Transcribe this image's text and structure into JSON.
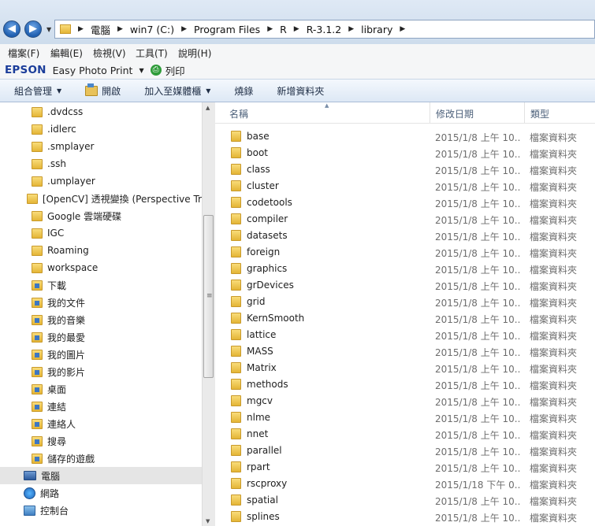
{
  "address": {
    "back_glyph": "◀",
    "forward_glyph": "▶",
    "crumbs": [
      "電腦",
      "win7 (C:)",
      "Program Files",
      "R",
      "R-3.1.2",
      "library"
    ]
  },
  "menu": [
    "檔案(F)",
    "編輯(E)",
    "檢視(V)",
    "工具(T)",
    "說明(H)"
  ],
  "epson": {
    "logo": "EPSON",
    "app": "Easy Photo Print",
    "print_label": "列印"
  },
  "toolbar": {
    "organize": "組合管理",
    "open": "開啟",
    "add_to_library": "加入至媒體櫃",
    "burn": "燒錄",
    "new_folder": "新增資料夾"
  },
  "sidebar": {
    "items": [
      {
        "label": ".dvdcss",
        "icon": "folder"
      },
      {
        "label": ".idlerc",
        "icon": "folder"
      },
      {
        "label": ".smplayer",
        "icon": "folder"
      },
      {
        "label": ".ssh",
        "icon": "folder"
      },
      {
        "label": ".umplayer",
        "icon": "folder"
      },
      {
        "label": "[OpenCV] 透視變換 (Perspective Tr",
        "icon": "folder"
      },
      {
        "label": "Google 雲端硬碟",
        "icon": "folder"
      },
      {
        "label": "IGC",
        "icon": "folder"
      },
      {
        "label": "Roaming",
        "icon": "folder"
      },
      {
        "label": "workspace",
        "icon": "folder"
      },
      {
        "label": "下載",
        "icon": "library-folder"
      },
      {
        "label": "我的文件",
        "icon": "library-folder"
      },
      {
        "label": "我的音樂",
        "icon": "library-folder"
      },
      {
        "label": "我的最愛",
        "icon": "library-folder"
      },
      {
        "label": "我的圖片",
        "icon": "library-folder"
      },
      {
        "label": "我的影片",
        "icon": "library-folder"
      },
      {
        "label": "桌面",
        "icon": "library-folder"
      },
      {
        "label": "連結",
        "icon": "library-folder"
      },
      {
        "label": "連絡人",
        "icon": "library-folder"
      },
      {
        "label": "搜尋",
        "icon": "library-folder"
      },
      {
        "label": "儲存的遊戲",
        "icon": "library-folder"
      },
      {
        "label": "電腦",
        "icon": "computer",
        "selected": true
      },
      {
        "label": "網路",
        "icon": "network"
      },
      {
        "label": "控制台",
        "icon": "control-panel"
      }
    ]
  },
  "file_list": {
    "columns": [
      "名稱",
      "修改日期",
      "類型"
    ],
    "rows": [
      {
        "name": "base",
        "date": "2015/1/8 上午 10...",
        "type": "檔案資料夾"
      },
      {
        "name": "boot",
        "date": "2015/1/8 上午 10...",
        "type": "檔案資料夾"
      },
      {
        "name": "class",
        "date": "2015/1/8 上午 10...",
        "type": "檔案資料夾"
      },
      {
        "name": "cluster",
        "date": "2015/1/8 上午 10...",
        "type": "檔案資料夾"
      },
      {
        "name": "codetools",
        "date": "2015/1/8 上午 10...",
        "type": "檔案資料夾"
      },
      {
        "name": "compiler",
        "date": "2015/1/8 上午 10...",
        "type": "檔案資料夾"
      },
      {
        "name": "datasets",
        "date": "2015/1/8 上午 10...",
        "type": "檔案資料夾"
      },
      {
        "name": "foreign",
        "date": "2015/1/8 上午 10...",
        "type": "檔案資料夾"
      },
      {
        "name": "graphics",
        "date": "2015/1/8 上午 10...",
        "type": "檔案資料夾"
      },
      {
        "name": "grDevices",
        "date": "2015/1/8 上午 10...",
        "type": "檔案資料夾"
      },
      {
        "name": "grid",
        "date": "2015/1/8 上午 10...",
        "type": "檔案資料夾"
      },
      {
        "name": "KernSmooth",
        "date": "2015/1/8 上午 10...",
        "type": "檔案資料夾"
      },
      {
        "name": "lattice",
        "date": "2015/1/8 上午 10...",
        "type": "檔案資料夾"
      },
      {
        "name": "MASS",
        "date": "2015/1/8 上午 10...",
        "type": "檔案資料夾"
      },
      {
        "name": "Matrix",
        "date": "2015/1/8 上午 10...",
        "type": "檔案資料夾"
      },
      {
        "name": "methods",
        "date": "2015/1/8 上午 10...",
        "type": "檔案資料夾"
      },
      {
        "name": "mgcv",
        "date": "2015/1/8 上午 10...",
        "type": "檔案資料夾"
      },
      {
        "name": "nlme",
        "date": "2015/1/8 上午 10...",
        "type": "檔案資料夾"
      },
      {
        "name": "nnet",
        "date": "2015/1/8 上午 10...",
        "type": "檔案資料夾"
      },
      {
        "name": "parallel",
        "date": "2015/1/8 上午 10...",
        "type": "檔案資料夾"
      },
      {
        "name": "rpart",
        "date": "2015/1/8 上午 10...",
        "type": "檔案資料夾"
      },
      {
        "name": "rscproxy",
        "date": "2015/1/18 下午 0...",
        "type": "檔案資料夾"
      },
      {
        "name": "spatial",
        "date": "2015/1/8 上午 10...",
        "type": "檔案資料夾"
      },
      {
        "name": "splines",
        "date": "2015/1/8 上午 10...",
        "type": "檔案資料夾"
      }
    ]
  }
}
